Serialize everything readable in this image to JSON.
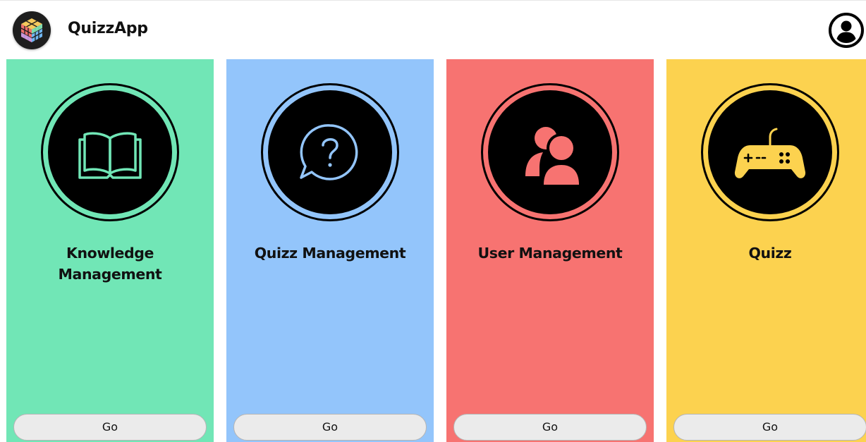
{
  "app": {
    "title": "QuizzApp",
    "logo_icon": "rubiks-cube-icon",
    "account_icon": "user-circle-icon"
  },
  "cards": [
    {
      "title": "Knowledge Management",
      "button": "Go",
      "icon": "open-book-icon",
      "color": "#71e6b6"
    },
    {
      "title": "Quizz Management",
      "button": "Go",
      "icon": "question-bubble-icon",
      "color": "#93c5fb"
    },
    {
      "title": "User Management",
      "button": "Go",
      "icon": "users-icon",
      "color": "#f77371"
    },
    {
      "title": "Quizz",
      "button": "Go",
      "icon": "gamepad-icon",
      "color": "#fcd24f"
    }
  ]
}
